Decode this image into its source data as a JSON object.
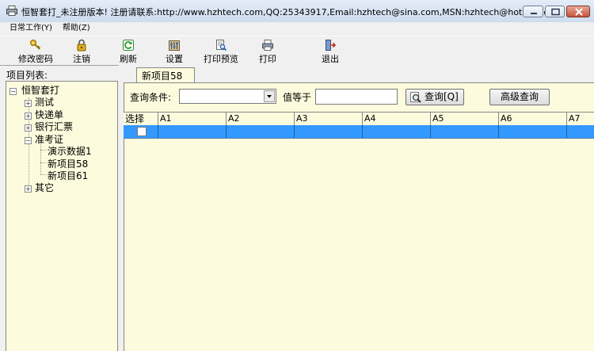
{
  "window": {
    "title": "恒智套打_未注册版本! 注册请联系:http://www.hzhtech.com,QQ:25343917,Email:hzhtech@sina.com,MSN:hzhtech@hotmail.com"
  },
  "menu": {
    "items": [
      {
        "label": "日常工作(Y)"
      },
      {
        "label": "帮助(Z)"
      }
    ]
  },
  "toolbar": {
    "buttons": [
      {
        "label": "修改密码",
        "icon": "key-icon"
      },
      {
        "label": "注销",
        "icon": "lock-icon"
      },
      {
        "label": "刷新",
        "icon": "refresh-icon"
      },
      {
        "label": "设置",
        "icon": "settings-icon"
      },
      {
        "label": "打印预览",
        "icon": "print-preview-icon"
      },
      {
        "label": "打印",
        "icon": "printer-icon"
      },
      {
        "label": "退出",
        "icon": "exit-icon"
      }
    ]
  },
  "left_panel": {
    "header": "项目列表:",
    "tree": {
      "root": "恒智套打",
      "nodes": [
        {
          "label": "测试",
          "expander": "+"
        },
        {
          "label": "快递单",
          "expander": "+"
        },
        {
          "label": "银行汇票",
          "expander": "+"
        },
        {
          "label": "准考证",
          "expander": "-"
        },
        {
          "label": "演示数据1"
        },
        {
          "label": "新项目58"
        },
        {
          "label": "新项目61"
        },
        {
          "label": "其它",
          "expander": "+"
        }
      ]
    }
  },
  "tabs": [
    {
      "label": "新项目58"
    }
  ],
  "query": {
    "condition_label": "查询条件:",
    "condition_value": "",
    "equals_label": "值等于",
    "value": "",
    "query_button": "查询[Q]",
    "advanced_button": "高级查询"
  },
  "grid": {
    "columns": [
      "选择",
      "A1",
      "A2",
      "A3",
      "A4",
      "A5",
      "A6",
      "A7"
    ],
    "rows": [
      {
        "selected": true,
        "checked": false
      }
    ]
  },
  "colors": {
    "panel_background": "#fcfbdd",
    "selection": "#3399ff",
    "chrome": "#f0f0f0"
  }
}
